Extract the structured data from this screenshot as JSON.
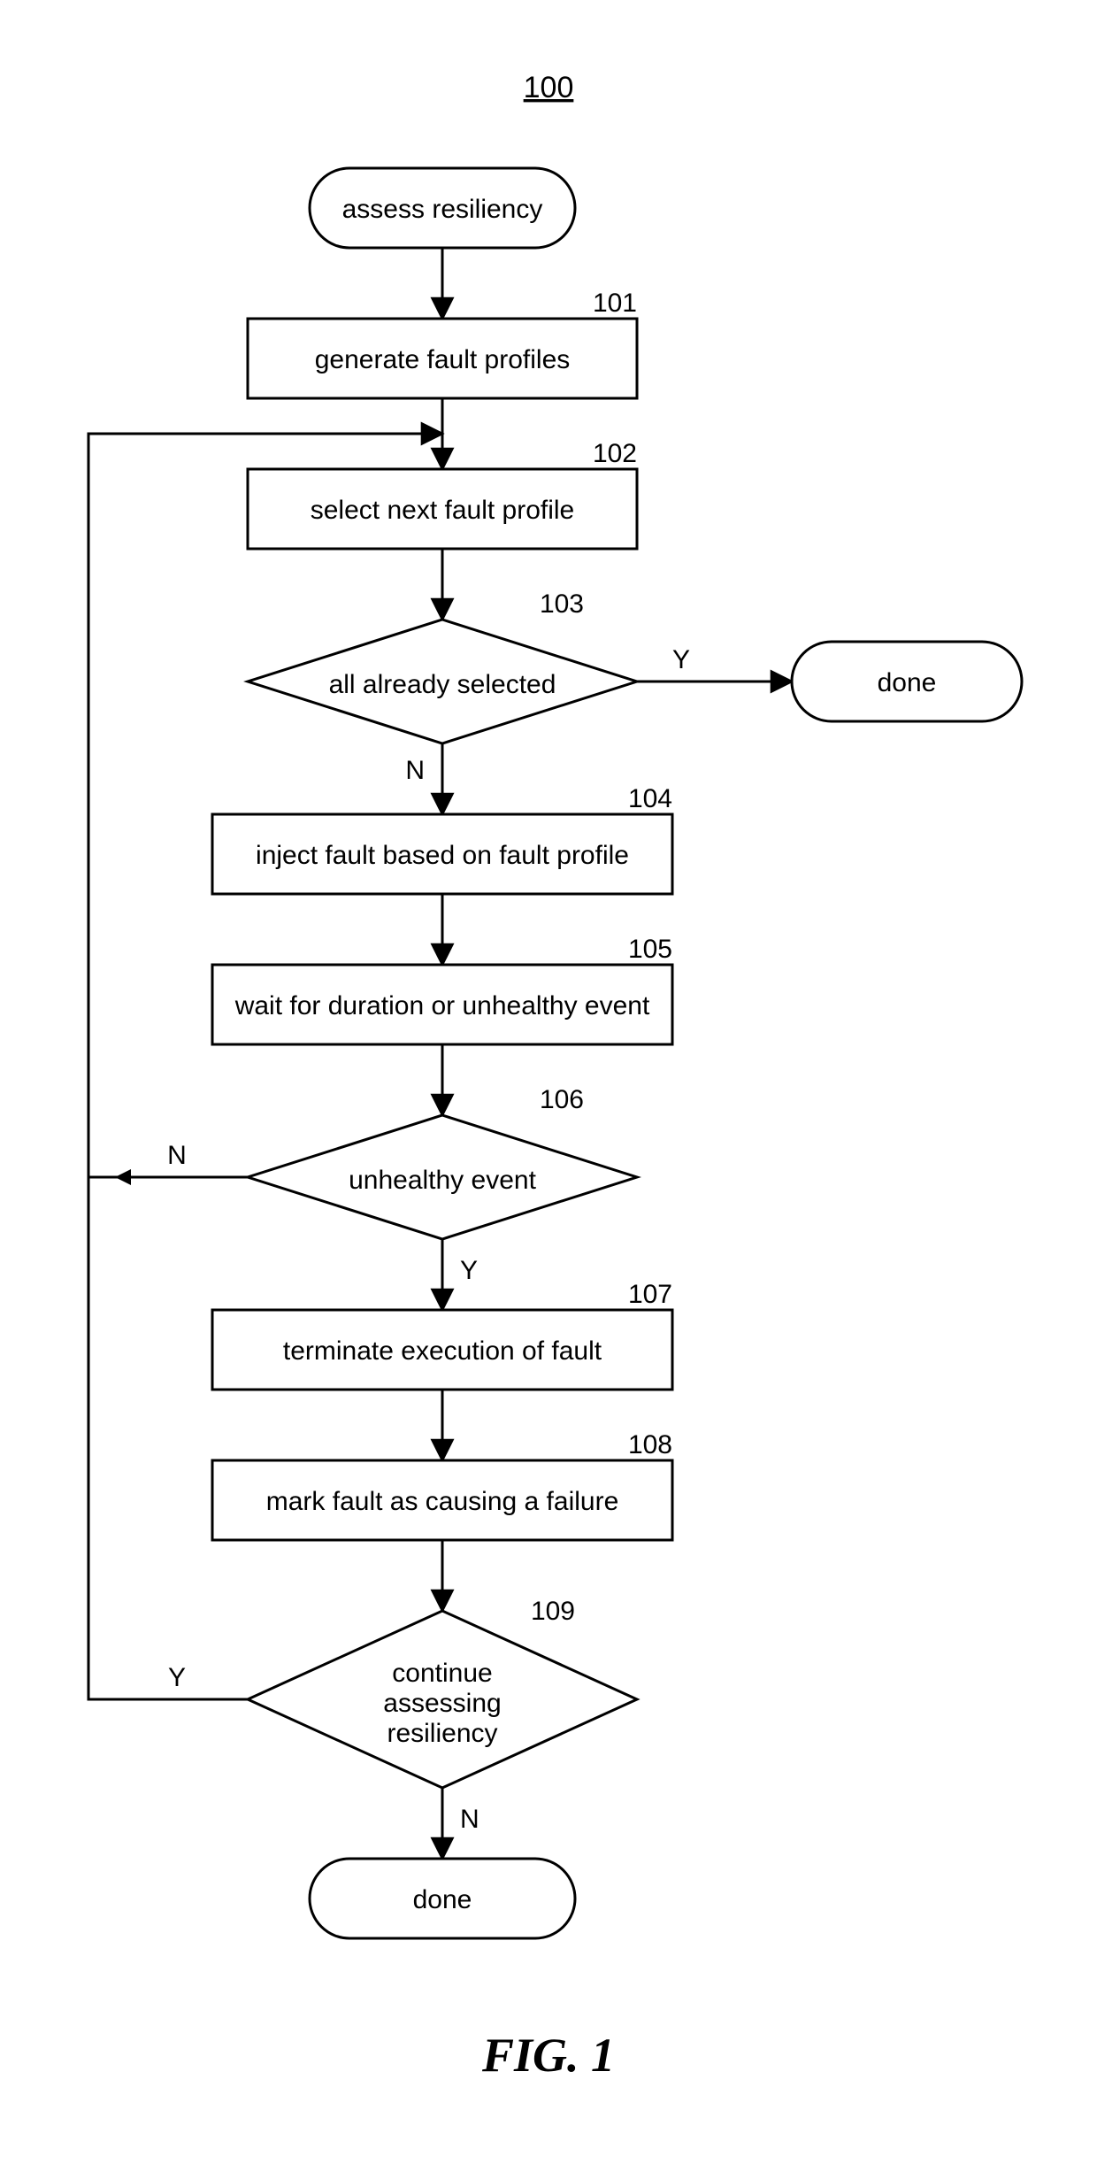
{
  "figure_number": "100",
  "figure_title": "FIG. 1",
  "nodes": {
    "start": {
      "num": "",
      "label": "assess resiliency"
    },
    "n101": {
      "num": "101",
      "label": "generate fault profiles"
    },
    "n102": {
      "num": "102",
      "label": "select next fault profile"
    },
    "n103": {
      "num": "103",
      "label": "all already selected"
    },
    "done_r": {
      "num": "",
      "label": "done"
    },
    "n104": {
      "num": "104",
      "label": "inject fault based on fault profile"
    },
    "n105": {
      "num": "105",
      "label": "wait for duration or unhealthy event"
    },
    "n106": {
      "num": "106",
      "label": "unhealthy event"
    },
    "n107": {
      "num": "107",
      "label": "terminate execution of fault"
    },
    "n108": {
      "num": "108",
      "label": "mark fault as causing a failure"
    },
    "n109": {
      "num": "109",
      "label1": "continue",
      "label2": "assessing",
      "label3": "resiliency"
    },
    "done_b": {
      "num": "",
      "label": "done"
    }
  },
  "edges": {
    "e103_Y": "Y",
    "e103_N": "N",
    "e106_Y": "Y",
    "e106_N": "N",
    "e109_Y": "Y",
    "e109_N": "N"
  }
}
